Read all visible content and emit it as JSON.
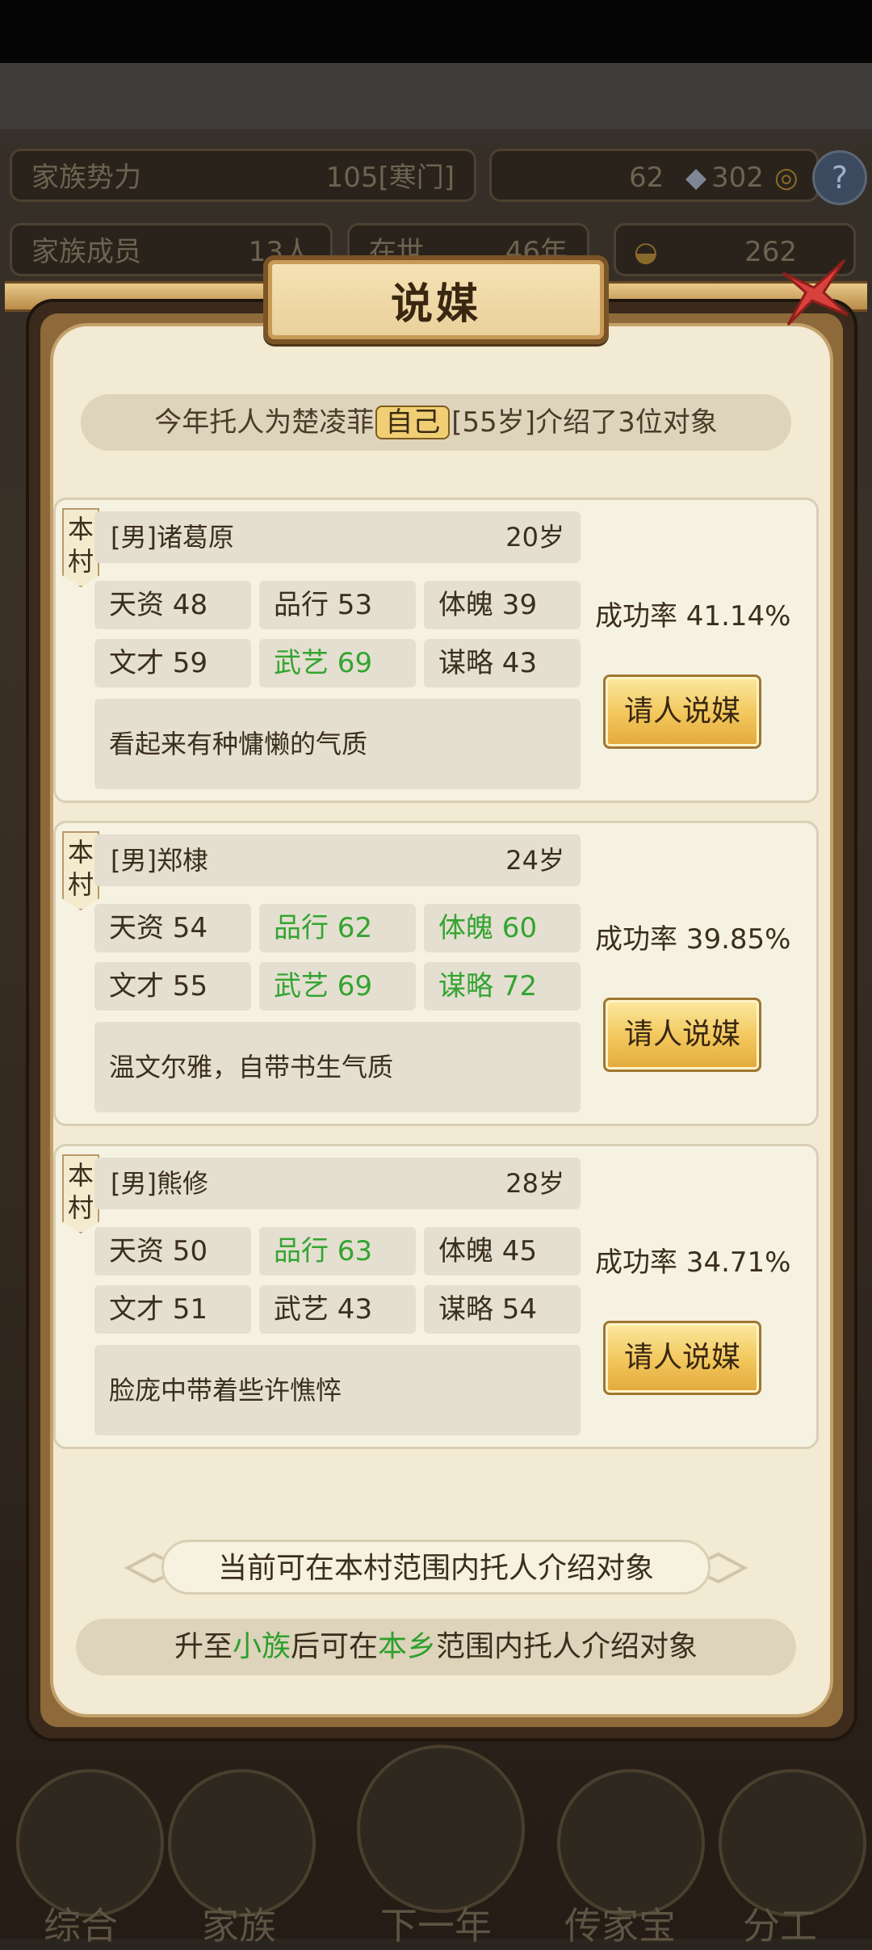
{
  "background": {
    "family_power_label": "家族势力",
    "family_power_value": "105[寒门]",
    "resources_left": "62",
    "resources_right": "302",
    "family_members_label": "家族成员",
    "family_members_value": "13人",
    "alive_label": "在世",
    "alive_value": "46年",
    "gold_value": "262",
    "help_icon": "?",
    "nav": [
      "综合",
      "家族",
      "下一年",
      "传家宝",
      "分工"
    ]
  },
  "dialog": {
    "title": "说媒",
    "summary_prefix": "今年托人为楚凌菲",
    "summary_tag": "自己",
    "summary_suffix": "[55岁]介绍了3位对象",
    "candidates": [
      {
        "village": "本村",
        "name": "[男]诸葛原",
        "age": "20岁",
        "stats": [
          {
            "text": "天资 48",
            "hi": false
          },
          {
            "text": "品行 53",
            "hi": false
          },
          {
            "text": "体魄 39",
            "hi": false
          },
          {
            "text": "文才 59",
            "hi": false
          },
          {
            "text": "武艺 69",
            "hi": true
          },
          {
            "text": "谋略 43",
            "hi": false
          }
        ],
        "desc": "看起来有种慵懒的气质",
        "rate": "成功率 41.14%",
        "button": "请人说媒"
      },
      {
        "village": "本村",
        "name": "[男]郑棣",
        "age": "24岁",
        "stats": [
          {
            "text": "天资 54",
            "hi": false
          },
          {
            "text": "品行 62",
            "hi": true
          },
          {
            "text": "体魄 60",
            "hi": true
          },
          {
            "text": "文才 55",
            "hi": false
          },
          {
            "text": "武艺 69",
            "hi": true
          },
          {
            "text": "谋略 72",
            "hi": true
          }
        ],
        "desc": "温文尔雅，自带书生气质",
        "rate": "成功率 39.85%",
        "button": "请人说媒"
      },
      {
        "village": "本村",
        "name": "[男]熊修",
        "age": "28岁",
        "stats": [
          {
            "text": "天资 50",
            "hi": false
          },
          {
            "text": "品行 63",
            "hi": true
          },
          {
            "text": "体魄 45",
            "hi": false
          },
          {
            "text": "文才 51",
            "hi": false
          },
          {
            "text": "武艺 43",
            "hi": false
          },
          {
            "text": "谋略 54",
            "hi": false
          }
        ],
        "desc": "脸庞中带着些许憔悴",
        "rate": "成功率 34.71%",
        "button": "请人说媒"
      }
    ],
    "scope_note": "当前可在本村范围内托人介绍对象",
    "upgrade_pre": "升至",
    "upgrade_rank": "小族",
    "upgrade_mid": "后可在",
    "upgrade_area": "本乡",
    "upgrade_post": "范围内托人介绍对象"
  },
  "colors": {
    "highlight_green": "#34a431",
    "paper": "#f2ead3",
    "frame_brown": "#8e6a3b",
    "button_gold": "#f2c65a"
  }
}
